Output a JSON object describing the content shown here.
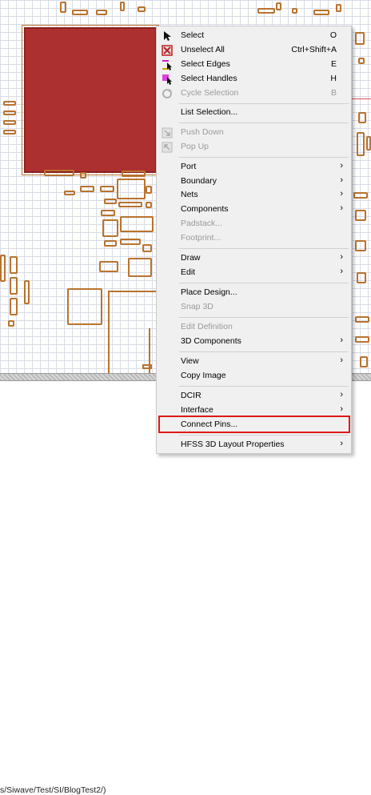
{
  "status_path": "s/Siwave/Test/SI/BlogTest2/)",
  "menu": {
    "items": [
      {
        "label": "Select",
        "shortcut": "O",
        "icon": "cursor-arrow-icon"
      },
      {
        "label": "Unselect All",
        "shortcut": "Ctrl+Shift+A",
        "icon": "unselect-all-icon"
      },
      {
        "label": "Select Edges",
        "shortcut": "E",
        "icon": "select-edges-icon"
      },
      {
        "label": "Select Handles",
        "shortcut": "H",
        "icon": "select-handles-icon"
      },
      {
        "label": "Cycle Selection",
        "shortcut": "B",
        "icon": "cycle-selection-icon"
      },
      {
        "label": "List Selection..."
      },
      {
        "label": "Push Down",
        "icon": "push-down-icon"
      },
      {
        "label": "Pop Up",
        "icon": "pop-up-icon"
      },
      {
        "label": "Port",
        "submenu": "›"
      },
      {
        "label": "Boundary",
        "submenu": "›"
      },
      {
        "label": "Nets",
        "submenu": "›"
      },
      {
        "label": "Components",
        "submenu": "›"
      },
      {
        "label": "Padstack..."
      },
      {
        "label": "Footprint..."
      },
      {
        "label": "Draw",
        "submenu": "›"
      },
      {
        "label": "Edit",
        "submenu": "›"
      },
      {
        "label": "Place Design..."
      },
      {
        "label": "Snap 3D"
      },
      {
        "label": "Edit Definition"
      },
      {
        "label": "3D Components",
        "submenu": "›"
      },
      {
        "label": "View",
        "submenu": "›"
      },
      {
        "label": "Copy Image"
      },
      {
        "label": "DCIR",
        "submenu": "›"
      },
      {
        "label": "Interface",
        "submenu": "›"
      },
      {
        "label": "Connect Pins..."
      },
      {
        "label": "HFSS 3D Layout Properties",
        "submenu": "›"
      }
    ]
  },
  "colors": {
    "accent": "#e01818",
    "copper": "#b8732e",
    "plane": "#ad3030"
  }
}
